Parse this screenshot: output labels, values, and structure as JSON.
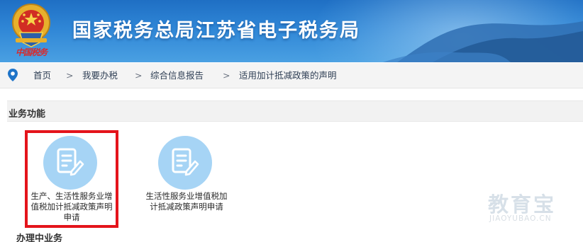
{
  "header": {
    "title": "国家税务总局江苏省电子税务局",
    "motto": "中国税务",
    "emblem_icon": "tax-emblem-icon"
  },
  "breadcrumb": {
    "pin_icon": "location-pin-icon",
    "items": [
      "首页",
      "我要办税",
      "综合信息报告",
      "适用加计抵减政策的声明"
    ],
    "separator": ">"
  },
  "business_functions": {
    "title": "业务功能",
    "cards": [
      {
        "icon": "form-edit-icon",
        "label": "生产、生活性服务业增值税加计抵减政策声明申请",
        "highlighted": true
      },
      {
        "icon": "form-edit-icon",
        "label": "生活性服务业增值税加计抵减政策声明申请",
        "highlighted": false
      }
    ]
  },
  "in_progress": {
    "title": "办理中业务"
  },
  "watermark": {
    "main": "教育宝",
    "sub": "JIAOYUBAO.CN"
  },
  "colors": {
    "header_blue": "#2f86d6",
    "highlight_red": "#e4141b",
    "icon_circle": "#a6d4f5",
    "emblem_red": "#d92a2a"
  }
}
